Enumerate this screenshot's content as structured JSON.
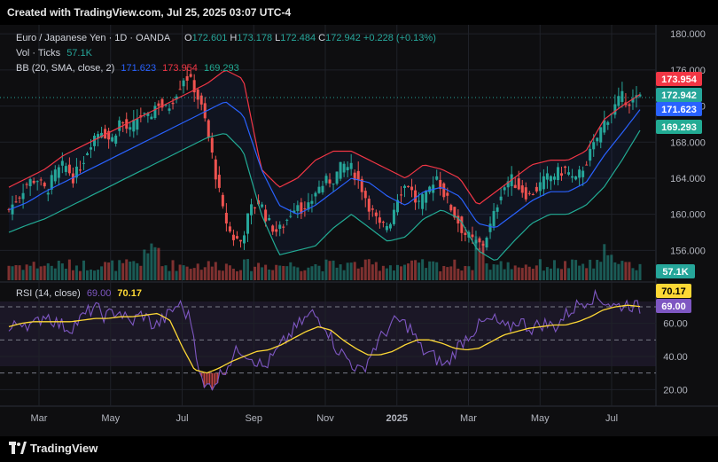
{
  "header": {
    "created_with": "Created with TradingView.com, Jul 25, 2025 03:07 UTC-4"
  },
  "footer": {
    "brand": "TradingView"
  },
  "legend": {
    "symbol": "Euro / Japanese Yen · 1D · OANDA",
    "o_label": "O",
    "o_value": "172.601",
    "h_label": "H",
    "h_value": "173.178",
    "l_label": "L",
    "l_value": "172.484",
    "c_label": "C",
    "c_value": "172.942",
    "change": "+0.228 (+0.13%)",
    "vol_label": "Vol · Ticks",
    "vol_value": "57.1K",
    "bb_label": "BB (20, SMA, close, 2)",
    "bb_basis": "171.623",
    "bb_upper": "173.954",
    "bb_lower": "169.293",
    "rsi_label": "RSI (14, close)",
    "rsi_value": "69.00",
    "rsi_ma_value": "70.17"
  },
  "price_badges": {
    "upper": "173.954",
    "close": "172.942",
    "basis": "171.623",
    "lower": "169.293",
    "volume": "57.1K"
  },
  "rsi_badges": {
    "ma": "70.17",
    "rsi": "69.00"
  },
  "colors": {
    "up": "#26a69a",
    "down": "#ef5350",
    "bb_upper": "#f23645",
    "bb_lower": "#22ab94",
    "bb_basis": "#2962ff",
    "rsi_line": "#7e57c2",
    "rsi_ma": "#fdd835",
    "background": "#0e0e10"
  },
  "chart_data": [
    {
      "type": "candlestick",
      "title": "Euro / Japanese Yen · 1D · OANDA",
      "x_ticks": [
        "Mar",
        "May",
        "Jul",
        "Sep",
        "Nov",
        "2025",
        "Mar",
        "May",
        "Jul"
      ],
      "y_ticks": [
        "180.000",
        "176.000",
        "172.000",
        "168.000",
        "164.000",
        "160.000",
        "156.000"
      ],
      "ylim": [
        152.5,
        181.0
      ],
      "grid": true,
      "series": [
        {
          "name": "Price (close)",
          "values": [
            160.5,
            162.0,
            163.5,
            164.0,
            162.5,
            164.5,
            165.5,
            164.0,
            166.0,
            168.5,
            169.5,
            168.0,
            170.5,
            169.0,
            171.0,
            170.5,
            172.5,
            171.5,
            173.5,
            175.5,
            174.0,
            171.0,
            166.0,
            160.5,
            157.5,
            157.0,
            160.5,
            161.5,
            159.0,
            158.0,
            159.5,
            161.5,
            160.0,
            162.5,
            163.5,
            164.0,
            165.5,
            165.0,
            163.0,
            160.5,
            158.5,
            159.0,
            162.5,
            163.5,
            161.0,
            162.0,
            164.5,
            162.0,
            160.0,
            158.0,
            157.0,
            156.5,
            159.0,
            162.5,
            164.0,
            163.0,
            162.0,
            163.0,
            164.0,
            164.5,
            165.0,
            163.5,
            165.5,
            167.5,
            170.0,
            171.5,
            173.0,
            172.5,
            172.94
          ]
        },
        {
          "name": "BB upper",
          "values": [
            163.0,
            164.0,
            165.0,
            166.5,
            167.5,
            168.5,
            169.5,
            170.5,
            171.5,
            172.5,
            173.5,
            174.5,
            176.0,
            175.0,
            165.0,
            163.0,
            164.0,
            166.0,
            167.0,
            167.0,
            166.0,
            165.0,
            164.0,
            165.5,
            165.0,
            164.0,
            161.0,
            162.5,
            164.0,
            165.5,
            166.0,
            166.0,
            167.0,
            170.5,
            172.0,
            173.3
          ]
        },
        {
          "name": "BB basis",
          "values": [
            160.5,
            161.3,
            162.5,
            163.5,
            164.5,
            165.5,
            166.5,
            167.5,
            168.5,
            169.5,
            170.5,
            171.5,
            172.5,
            171.0,
            165.0,
            161.0,
            160.0,
            161.0,
            162.5,
            164.0,
            163.5,
            162.0,
            161.0,
            162.5,
            163.0,
            162.0,
            159.0,
            158.5,
            160.0,
            161.5,
            162.5,
            162.5,
            163.5,
            166.5,
            169.0,
            171.6
          ]
        },
        {
          "name": "BB lower",
          "values": [
            158.0,
            158.8,
            159.5,
            160.5,
            161.5,
            162.5,
            163.5,
            164.5,
            165.5,
            166.5,
            167.5,
            168.5,
            169.0,
            167.0,
            160.0,
            155.5,
            156.0,
            156.5,
            158.5,
            160.0,
            158.5,
            157.0,
            157.5,
            159.5,
            160.5,
            159.5,
            156.0,
            154.8,
            157.0,
            159.0,
            160.0,
            160.0,
            161.0,
            163.0,
            166.0,
            169.3
          ]
        }
      ]
    },
    {
      "type": "line",
      "title": "RSI (14, close)",
      "y_ticks": [
        "60.00",
        "40.00",
        "20.00"
      ],
      "ylim": [
        10,
        85
      ],
      "series": [
        {
          "name": "RSI",
          "values": [
            55,
            62,
            58,
            66,
            60,
            57,
            63,
            70,
            64,
            68,
            60,
            66,
            58,
            64,
            72,
            62,
            20,
            25,
            35,
            45,
            40,
            33,
            42,
            52,
            60,
            66,
            60,
            45,
            38,
            30,
            44,
            55,
            62,
            58,
            44,
            40,
            34,
            46,
            54,
            60,
            62,
            56,
            62,
            57,
            60,
            58,
            66,
            72,
            76,
            74,
            70,
            72,
            69
          ]
        },
        {
          "name": "RSI-based MA",
          "values": [
            58,
            60,
            61,
            61,
            61,
            61,
            62,
            63,
            63,
            64,
            64,
            65,
            66,
            62,
            46,
            32,
            30,
            33,
            37,
            40,
            43,
            44,
            47,
            51,
            55,
            58,
            56,
            50,
            45,
            41,
            41,
            43,
            47,
            50,
            50,
            48,
            45,
            44,
            45,
            49,
            53,
            55,
            57,
            58,
            59,
            59,
            61,
            64,
            68,
            70,
            71,
            70.17
          ]
        }
      ]
    }
  ]
}
